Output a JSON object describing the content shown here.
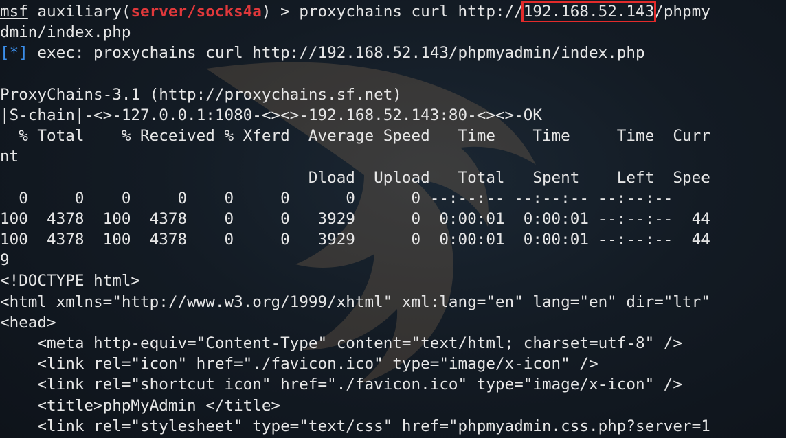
{
  "prompt": {
    "console": "msf",
    "space1": " ",
    "keyword": "auxiliary(",
    "module": "server/socks4a",
    "close": ") > ",
    "command_prefix": "proxychains curl http://",
    "command_ip": "192.168.52.143",
    "command_suffix": "/phpmy"
  },
  "wrap1": "dmin/index.php",
  "exec_line": {
    "tag": "[*]",
    "text": " exec: proxychains curl http://192.168.52.143/phpmyadmin/index.php"
  },
  "blank1": "",
  "proxychains_version": "ProxyChains-3.1 (http://proxychains.sf.net)",
  "chain_line": "|S-chain|-<>-127.0.0.1:1080-<><>-192.168.52.143:80-<><>-OK",
  "curl_header1": "  % Total    % Received % Xferd  Average Speed   Time    Time     Time  Curr",
  "curl_header1_wrap": "nt",
  "curl_header2": "                                 Dload  Upload   Total   Spent    Left  Spee",
  "progress_rows": [
    "  0     0    0     0    0     0      0      0 --:--:-- --:--:-- --:--:--     ",
    "100  4378  100  4378    0     0   3929      0  0:00:01  0:00:01 --:--:--  44",
    "100  4378  100  4378    0     0   3929      0  0:00:01  0:00:01 --:--:--  44"
  ],
  "progress_wrap": "9",
  "html_output": [
    "<!DOCTYPE html>",
    "<html xmlns=\"http://www.w3.org/1999/xhtml\" xml:lang=\"en\" lang=\"en\" dir=\"ltr\"",
    "<head>",
    "    <meta http-equiv=\"Content-Type\" content=\"text/html; charset=utf-8\" />",
    "    <link rel=\"icon\" href=\"./favicon.ico\" type=\"image/x-icon\" />",
    "    <link rel=\"shortcut icon\" href=\"./favicon.ico\" type=\"image/x-icon\" />",
    "    <title>phpMyAdmin </title>",
    "    <link rel=\"stylesheet\" type=\"text/css\" href=\"phpmyadmin.css.php?server=1"
  ],
  "colors": {
    "background": "#131b24",
    "text": "#e6e6e6",
    "module": "#e0383b",
    "exec_tag": "#3b8eea",
    "highlight_box": "#e22b2b"
  },
  "icons": {
    "watermark": "kali-dragon-icon"
  }
}
